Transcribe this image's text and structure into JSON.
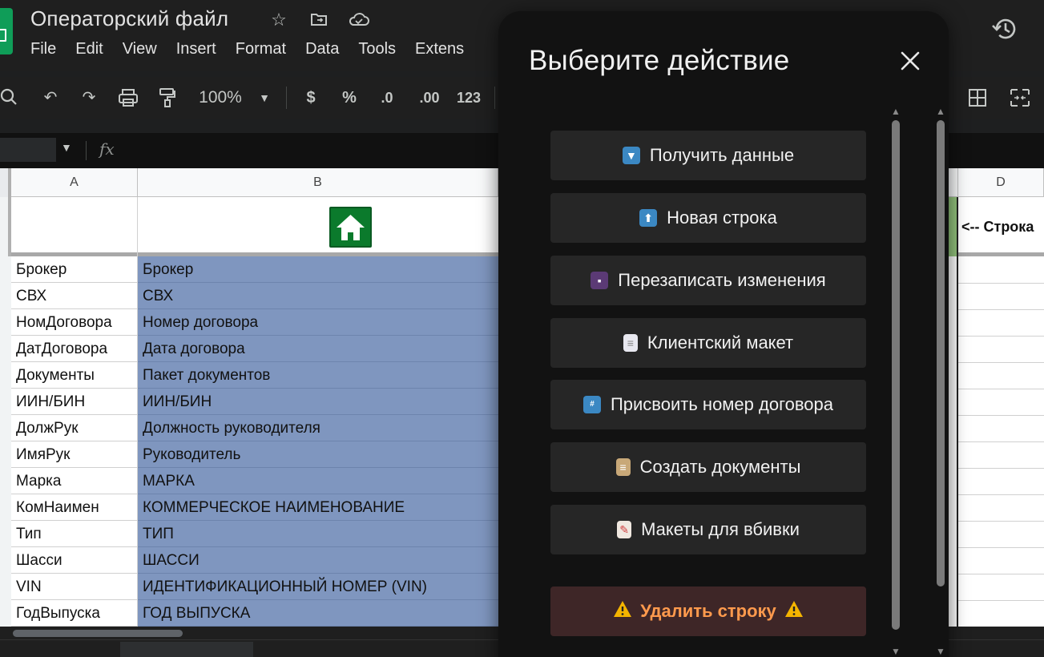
{
  "app": {
    "doc_title": "Операторский файл",
    "menu": [
      "File",
      "Edit",
      "View",
      "Insert",
      "Format",
      "Data",
      "Tools",
      "Extens"
    ]
  },
  "toolbar": {
    "zoom": "100%",
    "currency": "$",
    "percent": "%",
    "decrease_decimals": ".0",
    "increase_decimals": ".00",
    "number_format": "123"
  },
  "formula_bar": {
    "fx": "fx"
  },
  "grid": {
    "columns": [
      "A",
      "B",
      "D"
    ],
    "header_cell_d": "<-- Строка",
    "rows": [
      {
        "a": "Брокер",
        "b": "Брокер"
      },
      {
        "a": "СВХ",
        "b": "СВХ"
      },
      {
        "a": "НомДоговора",
        "b": "Номер договора"
      },
      {
        "a": "ДатДоговора",
        "b": "Дата договора"
      },
      {
        "a": "Документы",
        "b": "Пакет документов"
      },
      {
        "a": "ИИН/БИН",
        "b": "ИИН/БИН"
      },
      {
        "a": "ДолжРук",
        "b": "Должность руководителя"
      },
      {
        "a": "ИмяРук",
        "b": "Руководитель"
      },
      {
        "a": "Марка",
        "b": "МАРКА"
      },
      {
        "a": "КомНаимен",
        "b": "КОММЕРЧЕСКОЕ НАИМЕНОВАНИЕ"
      },
      {
        "a": "Тип",
        "b": "ТИП"
      },
      {
        "a": "Шасси",
        "b": "ШАССИ"
      },
      {
        "a": "VIN",
        "b": "ИДЕНТИФИКАЦИОННЫЙ НОМЕР (VIN)"
      },
      {
        "a": "ГодВыпуска",
        "b": "ГОД ВЫПУСКА"
      }
    ]
  },
  "dialog": {
    "title": "Выберите действие",
    "buttons": [
      {
        "label": "Получить данные",
        "icon": "down-arrow-icon"
      },
      {
        "label": "Новая строка",
        "icon": "up-arrow-icon"
      },
      {
        "label": "Перезаписать изменения",
        "icon": "floppy-disk-icon"
      },
      {
        "label": "Клиентский макет",
        "icon": "page-icon"
      },
      {
        "label": "Присвоить номер договора",
        "icon": "numbers-icon"
      },
      {
        "label": "Создать документы",
        "icon": "clipboard-icon"
      },
      {
        "label": "Макеты для вбивки",
        "icon": "memo-icon"
      }
    ],
    "delete_button": {
      "label": "Удалить строку",
      "icon": "warning-icon"
    }
  },
  "colors": {
    "selected_column": "#7f96bf",
    "dialog_bg": "#121212",
    "button_bg": "#262626",
    "delete_bg": "#3e2627",
    "delete_text": "#ff9a4d",
    "sheets_green": "#0f9d58"
  }
}
